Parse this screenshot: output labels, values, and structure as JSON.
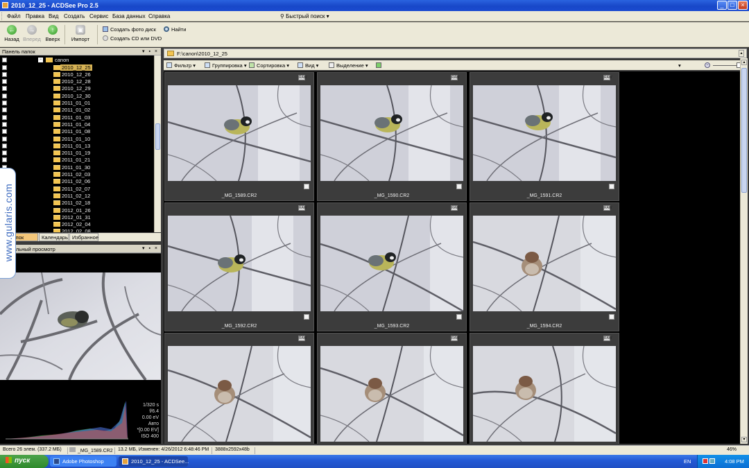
{
  "window": {
    "title": "2010_12_25 - ACDSee Pro 2.5"
  },
  "menu": [
    "Файл",
    "Правка",
    "Вид",
    "Создать",
    "Сервис",
    "База данных",
    "Справка"
  ],
  "quick_search": {
    "label": "Быстрый поиск"
  },
  "toolbar": {
    "back": "Назад",
    "forward": "Вперед",
    "up": "Вверх",
    "import": "Импорт",
    "create_photo_disc": "Создать фото диск",
    "create_cd_dvd": "Создать CD или DVD",
    "find": "Найти"
  },
  "folders_panel": {
    "title": "Панель папок",
    "root": "canon",
    "items": [
      "2010_12_25",
      "2010_12_26",
      "2010_12_28",
      "2010_12_29",
      "2010_12_30",
      "2011_01_01",
      "2011_01_02",
      "2011_01_03",
      "2011_01_04",
      "2011_01_08",
      "2011_01_10",
      "2011_01_13",
      "2011_01_19",
      "2011_01_21",
      "2011_01_30",
      "2011_02_03",
      "2011_02_06",
      "2011_02_07",
      "2011_02_12",
      "2011_02_18",
      "2012_01_26",
      "2012_01_31",
      "2012_02_04",
      "2012_02_08"
    ],
    "selected": "2010_12_25",
    "tabs": [
      "ль папок",
      "Календарь",
      "Избранное"
    ]
  },
  "preview_panel": {
    "title": "арительный просмотр",
    "exif": [
      "1/320 s",
      "f/6.4",
      "0.00 eV",
      "Авто",
      "*[0.00 EV]",
      "ISO 400"
    ]
  },
  "watermark": "www.gularis.com",
  "path": "F:\\canon\\2010_12_25",
  "filter_bar": {
    "filter": "Фильтр",
    "group": "Группировка",
    "sort": "Сортировка",
    "view": "Вид",
    "select": "Выделение"
  },
  "thumbnails": [
    {
      "name": "_MG_1589.CR2",
      "bird": "tit"
    },
    {
      "name": "_MG_1590.CR2",
      "bird": "tit"
    },
    {
      "name": "_MG_1591.CR2",
      "bird": "tit"
    },
    {
      "name": "_MG_1592.CR2",
      "bird": "tit"
    },
    {
      "name": "_MG_1593.CR2",
      "bird": "tit"
    },
    {
      "name": "_MG_1594.CR2",
      "bird": "sparrow"
    },
    {
      "name": "",
      "bird": "sparrow"
    },
    {
      "name": "",
      "bird": "sparrow"
    },
    {
      "name": "",
      "bird": "sparrow"
    }
  ],
  "status": {
    "total": "Всего 26 элем.  (337.2 МБ)",
    "current_file": "_MG_1589.CR2",
    "info": "13.2 МБ, Изменен: 4/26/2012 6:48:46 PM",
    "dims": "3888x2592x48b",
    "zoom": "46%"
  },
  "taskbar": {
    "start": "пуск",
    "tasks": [
      "Adobe Photoshop",
      "2010_12_25 - ACDSee..."
    ],
    "lang": "EN",
    "time": "4:08 PM"
  },
  "colors": {
    "xp_blue": "#245ad6",
    "start_green": "#2f8a2c",
    "selection": "#d6b255"
  }
}
